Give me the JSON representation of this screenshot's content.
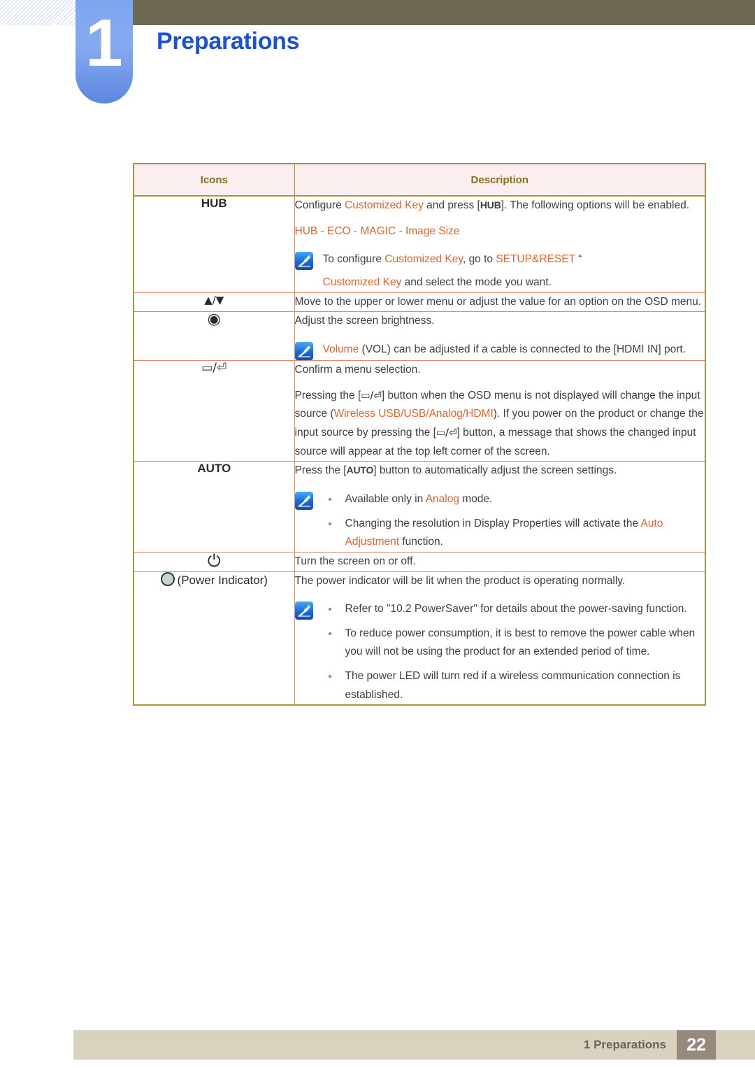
{
  "header": {
    "chapter_number": "1",
    "title": "Preparations"
  },
  "table": {
    "columns": [
      "Icons",
      "Description"
    ],
    "rows": [
      {
        "icon_label": "HUB",
        "icon_name": "hub-button-icon",
        "paragraphs": [
          {
            "type": "rich",
            "segments": [
              {
                "t": "Configure ",
                "c": "plain"
              },
              {
                "t": "Customized Key",
                "c": "orange"
              },
              {
                "t": " and press [",
                "c": "plain"
              },
              {
                "t": "HUB",
                "c": "key"
              },
              {
                "t": "]. The following options will be enabled.",
                "c": "plain"
              }
            ]
          },
          {
            "type": "rich",
            "segments": [
              {
                "t": "HUB - ECO - MAGIC - Image Size",
                "c": "orange"
              }
            ]
          }
        ],
        "note": {
          "lines": [
            {
              "segments": [
                {
                  "t": "To configure ",
                  "c": "plain"
                },
                {
                  "t": "Customized Key",
                  "c": "orange"
                },
                {
                  "t": ", go to ",
                  "c": "plain"
                },
                {
                  "t": "SETUP&RESET",
                  "c": "orange"
                },
                {
                  "t": "  “",
                  "c": "plain"
                }
              ]
            },
            {
              "segments": [
                {
                  "t": "Customized Key",
                  "c": "orange"
                },
                {
                  "t": " and select the mode you want.",
                  "c": "plain"
                }
              ]
            }
          ]
        }
      },
      {
        "icon_label": "▲/▼",
        "icon_name": "up-down-arrows-icon",
        "paragraphs": [
          {
            "type": "rich",
            "segments": [
              {
                "t": "Move to the upper or lower menu or adjust the value for an option on the OSD menu.",
                "c": "plain"
              }
            ]
          }
        ]
      },
      {
        "icon_label": "◉",
        "icon_name": "brightness-dial-icon",
        "paragraphs": [
          {
            "type": "rich",
            "segments": [
              {
                "t": "Adjust the screen brightness.",
                "c": "plain"
              }
            ]
          }
        ],
        "note": {
          "lines": [
            {
              "segments": [
                {
                  "t": "Volume",
                  "c": "orange"
                },
                {
                  "t": " (VOL) can be adjusted if a cable is connected to the [HDMI IN] port.",
                  "c": "plain"
                }
              ]
            }
          ]
        }
      },
      {
        "icon_label": "▭/⏎",
        "icon_name": "source-enter-icon",
        "paragraphs": [
          {
            "type": "rich",
            "segments": [
              {
                "t": "Confirm a menu selection.",
                "c": "plain"
              }
            ]
          },
          {
            "type": "rich",
            "segments": [
              {
                "t": "Pressing the [",
                "c": "plain"
              },
              {
                "t": "▭/⏎",
                "c": "keyglyph"
              },
              {
                "t": "] button when the OSD menu is not displayed will change the input source (",
                "c": "plain"
              },
              {
                "t": "Wireless USB/USB/Analog/HDMI",
                "c": "orange"
              },
              {
                "t": "). If you power on the product or change the input source by pressing the [",
                "c": "plain"
              },
              {
                "t": "▭/⏎",
                "c": "keyglyph"
              },
              {
                "t": "] button, a message that shows the changed input source will appear at the top left corner of the screen.",
                "c": "plain"
              }
            ]
          }
        ]
      },
      {
        "icon_label": "AUTO",
        "icon_name": "auto-button-icon",
        "paragraphs": [
          {
            "type": "rich",
            "segments": [
              {
                "t": "Press the [",
                "c": "plain"
              },
              {
                "t": "AUTO",
                "c": "key"
              },
              {
                "t": "] button to automatically adjust the screen settings.",
                "c": "plain"
              }
            ]
          }
        ],
        "note": {
          "bullets": [
            {
              "segments": [
                {
                  "t": "Available only in ",
                  "c": "plain"
                },
                {
                  "t": "Analog",
                  "c": "orange"
                },
                {
                  "t": " mode.",
                  "c": "plain"
                }
              ]
            },
            {
              "segments": [
                {
                  "t": "Changing the resolution in Display Properties will activate the ",
                  "c": "plain"
                },
                {
                  "t": "Auto Adjustment",
                  "c": "orange"
                },
                {
                  "t": " function.",
                  "c": "plain"
                }
              ]
            }
          ]
        }
      },
      {
        "icon_label": "⏻",
        "icon_name": "power-button-icon",
        "paragraphs": [
          {
            "type": "rich",
            "segments": [
              {
                "t": "Turn the screen on or off.",
                "c": "plain"
              }
            ]
          }
        ]
      },
      {
        "icon_label": "(Power Indicator)",
        "icon_name": "power-indicator-icon",
        "paragraphs": [
          {
            "type": "rich",
            "segments": [
              {
                "t": "The power indicator will be lit when the product is operating normally.",
                "c": "plain"
              }
            ]
          }
        ],
        "note": {
          "bullets": [
            {
              "segments": [
                {
                  "t": "Refer to \"10.2 PowerSaver\" for details about the power-saving function.",
                  "c": "plain"
                }
              ]
            },
            {
              "segments": [
                {
                  "t": "To reduce power consumption, it is best to remove the power cable when you will not be using the product for an extended period of time.",
                  "c": "plain"
                }
              ]
            },
            {
              "segments": [
                {
                  "t": "The power LED will turn red if a wireless communication connection is established.",
                  "c": "plain"
                }
              ]
            }
          ]
        }
      }
    ]
  },
  "footer": {
    "chapter_label": "1 Preparations",
    "page_number": "22"
  },
  "colors": {
    "header_band": "#6e6a52",
    "chapter_tab": "#7da6ef",
    "title_blue": "#1a52d4",
    "accent_orange": "#e8622a",
    "table_border": "#b0922f",
    "table_header_bg": "#fbeeee",
    "table_header_text": "#8a6d1f",
    "inner_border": "#e8a88c",
    "footer_bar": "#d8d2bf",
    "footer_page_box": "#968a7f"
  }
}
